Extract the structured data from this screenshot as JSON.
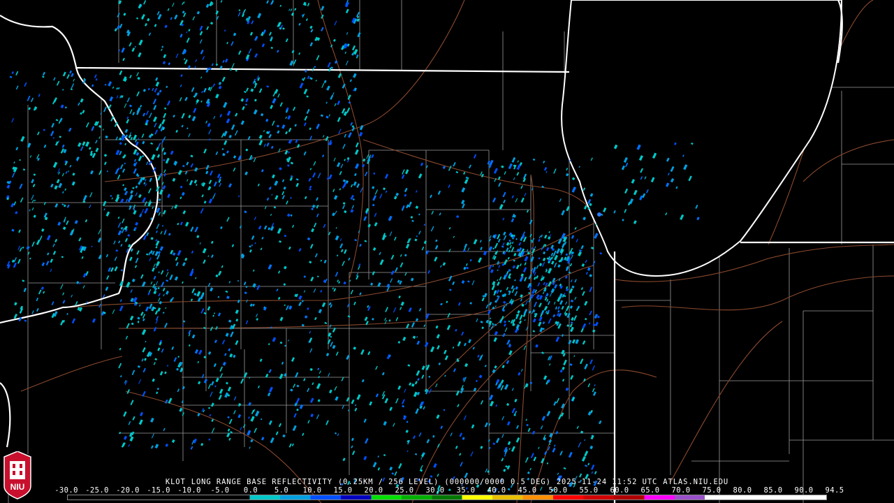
{
  "product": {
    "radar": "KLOT",
    "title": "LONG RANGE BASE REFLECTIVITY",
    "resolution": "(0.25KM / 256 LEVEL)",
    "volume_code": "(000000/0000",
    "elevation": "0.5 DEG)",
    "timestamp": "2025-11-24 11:52 UTC",
    "source": "ATLAS.NIU.EDU"
  },
  "logo": {
    "text": "NIU",
    "icon": "niu-tower-logo-icon",
    "color": "#c8102e"
  },
  "colors": {
    "state_lines": "#ffffff",
    "county_lines": "#9a9a9a",
    "highways": "#8b4a2e",
    "background": "#000000"
  },
  "scale": {
    "labels": [
      "-30.0",
      "-25.0",
      "-20.0",
      "-15.0",
      "-10.0",
      "-5.0",
      "0.0",
      "5.0",
      "10.0",
      "15.0",
      "20.0",
      "25.0",
      "30.0",
      "35.0",
      "40.0",
      "45.0",
      "50.0",
      "55.0",
      "60.0",
      "65.0",
      "70.0",
      "75.0",
      "80.0",
      "85.0",
      "90.0",
      "94.5"
    ],
    "colors": [
      "#000000",
      "#000000",
      "#000000",
      "#000000",
      "#000000",
      "#000000",
      "#00c8c8",
      "#00a0e0",
      "#0050ff",
      "#0000c0",
      "#00e000",
      "#00b000",
      "#007800",
      "#ffff00",
      "#e8c000",
      "#ff9000",
      "#ff0000",
      "#d00000",
      "#b00000",
      "#ff00ff",
      "#9a50c8",
      "#ffffff",
      "#ffffff",
      "#ffffff",
      "#ffffff"
    ]
  }
}
